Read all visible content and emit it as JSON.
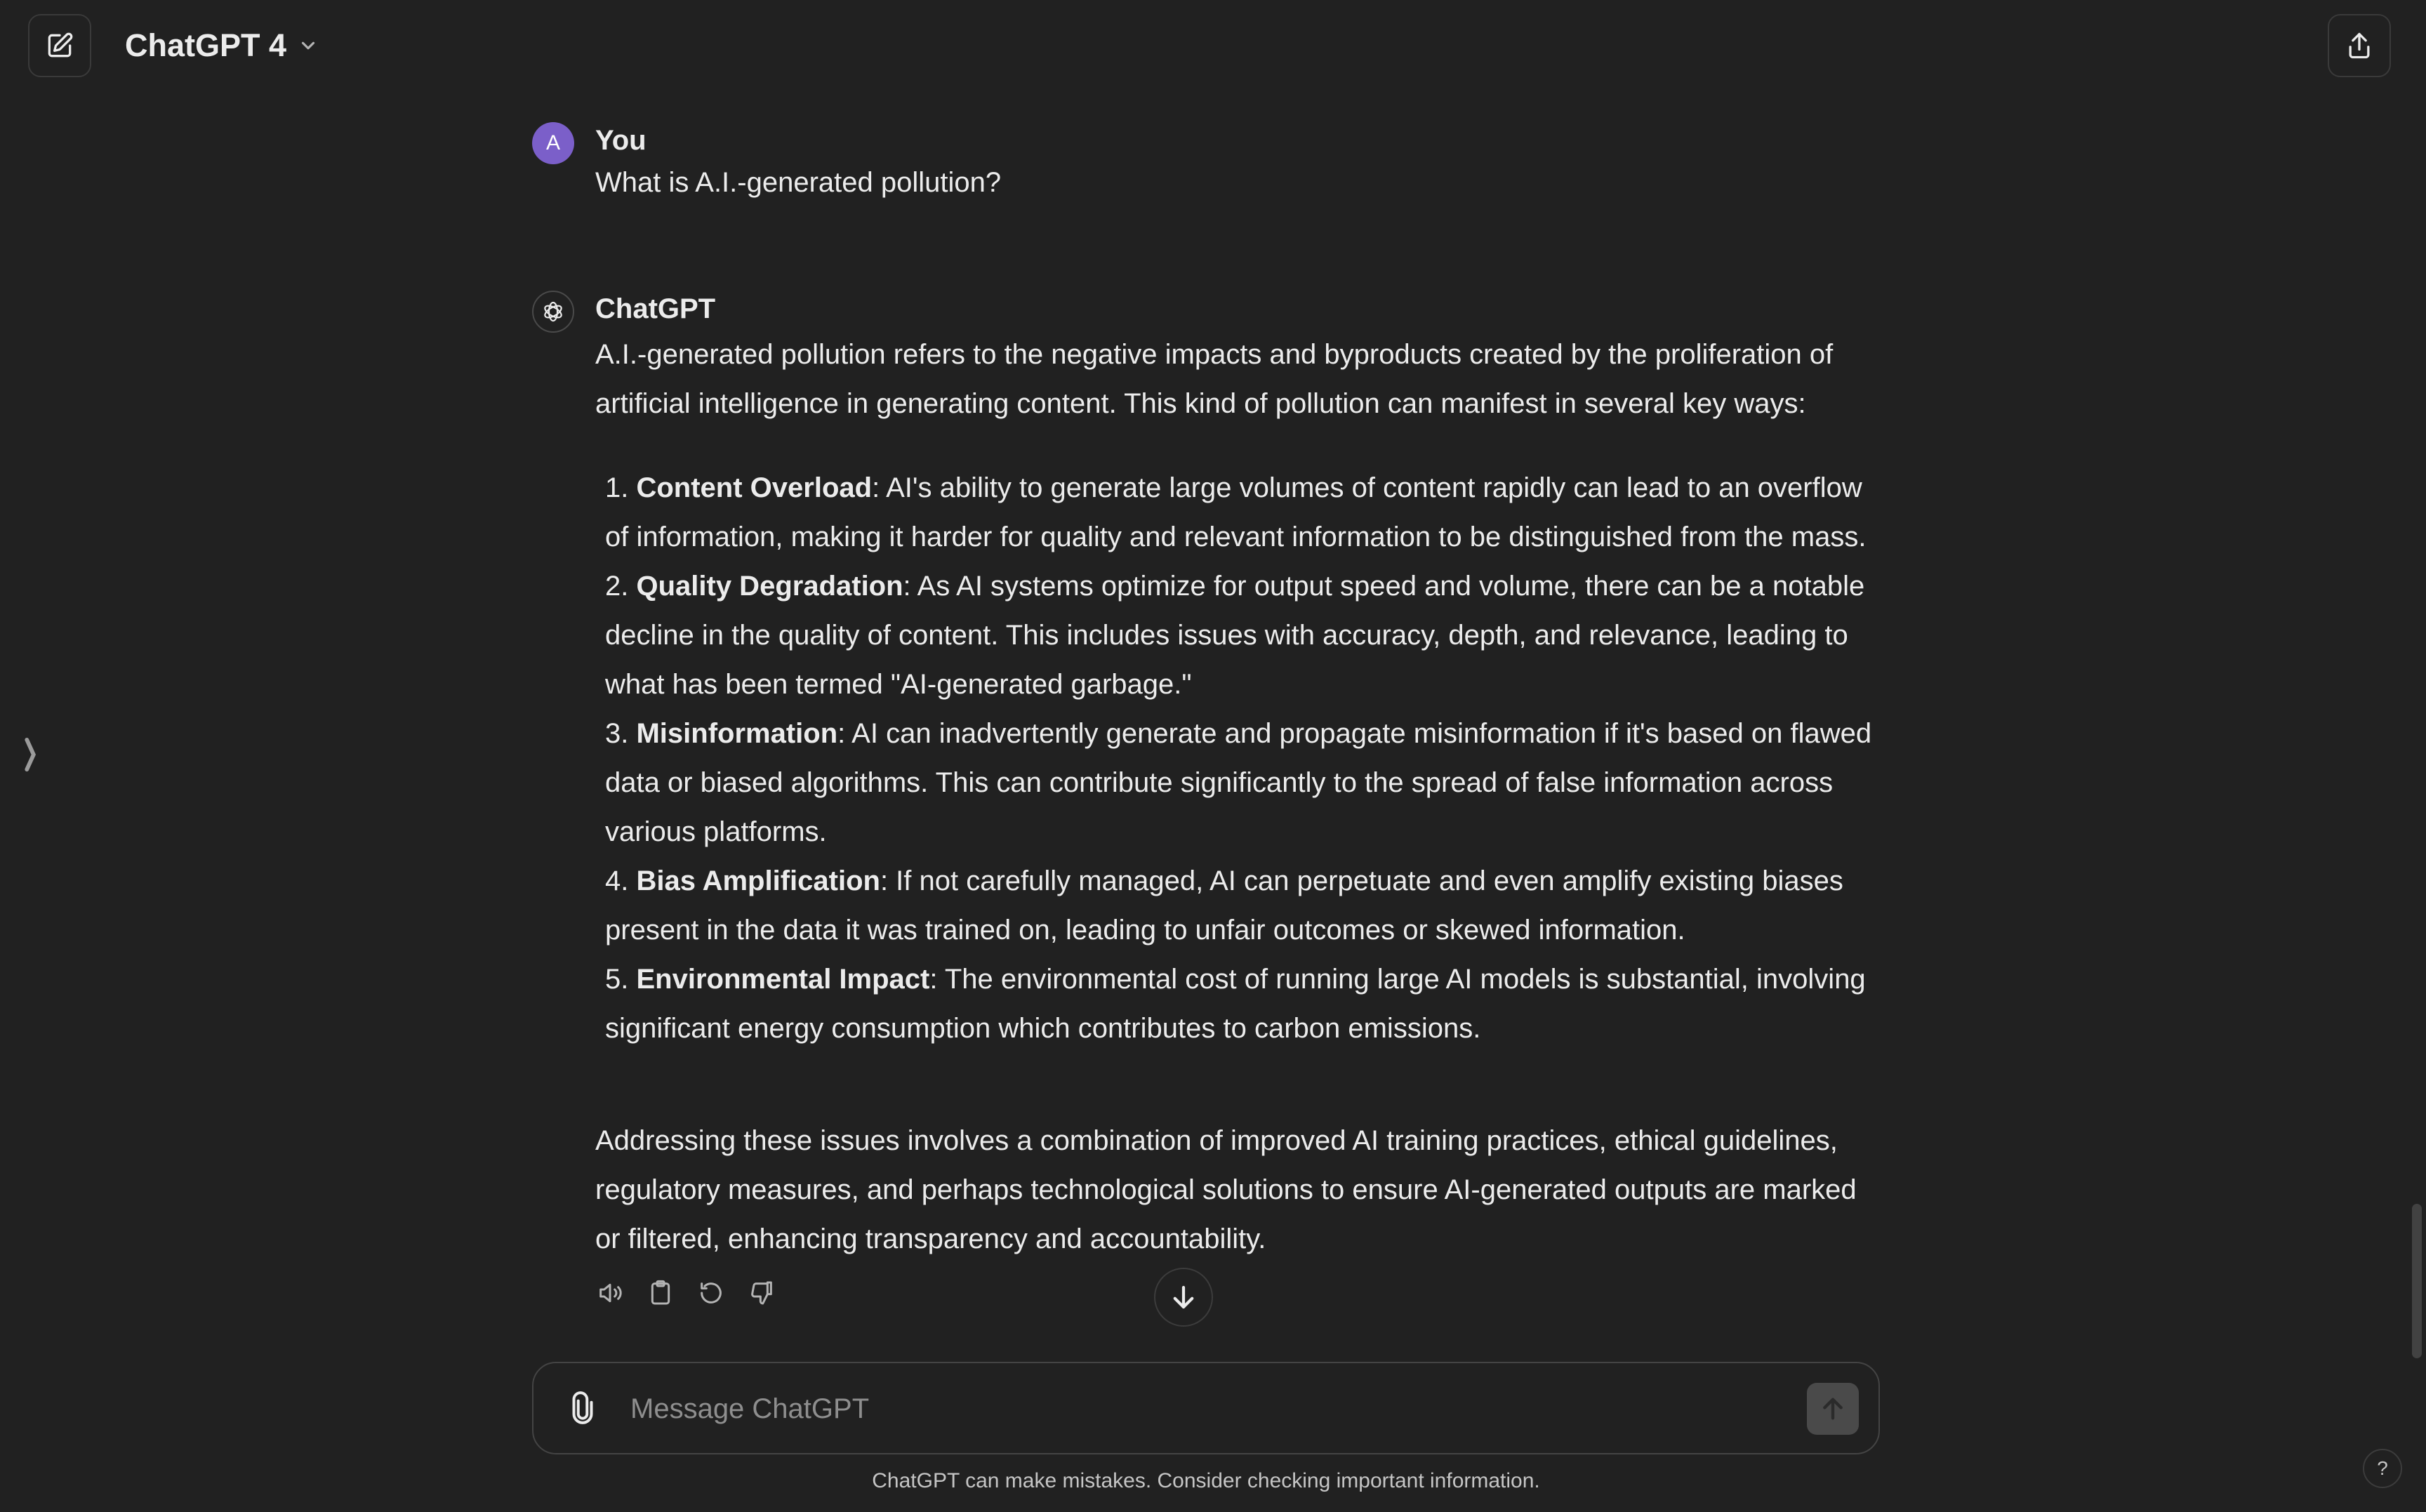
{
  "header": {
    "model_name": "ChatGPT 4",
    "icons": {
      "new_chat": "edit-icon",
      "share": "share-icon",
      "dropdown": "chevron-down-icon"
    }
  },
  "conversation": {
    "user": {
      "avatar_letter": "A",
      "author": "You",
      "text": "What is A.I.-generated pollution?"
    },
    "assistant": {
      "author": "ChatGPT",
      "intro": "A.I.-generated pollution refers to the negative impacts and byproducts created by the proliferation of artificial intelligence in generating content. This kind of pollution can manifest in several key ways:",
      "items": [
        {
          "num": "1.",
          "title": "Content Overload",
          "text": ": AI's ability to generate large volumes of content rapidly can lead to an overflow of information, making it harder for quality and relevant information to be distinguished from the mass."
        },
        {
          "num": "2.",
          "title": "Quality Degradation",
          "text": ": As AI systems optimize for output speed and volume, there can be a notable decline in the quality of content. This includes issues with accuracy, depth, and relevance, leading to what has been termed \"AI-generated garbage.\""
        },
        {
          "num": "3.",
          "title": "Misinformation",
          "text": ": AI can inadvertently generate and propagate misinformation if it's based on flawed data or biased algorithms. This can contribute significantly to the spread of false information across various platforms."
        },
        {
          "num": "4.",
          "title": "Bias Amplification",
          "text": ": If not carefully managed, AI can perpetuate and even amplify existing biases present in the data it was trained on, leading to unfair outcomes or skewed information."
        },
        {
          "num": "5.",
          "title": "Environmental Impact",
          "text": ": The environmental cost of running large AI models is substantial, involving significant energy consumption which contributes to carbon emissions."
        }
      ],
      "closing": "Addressing these issues involves a combination of improved AI training practices, ethical guidelines, regulatory measures, and perhaps technological solutions to ensure AI-generated outputs are marked or filtered, enhancing transparency and accountability."
    }
  },
  "composer": {
    "placeholder": "Message ChatGPT"
  },
  "footer": {
    "disclaimer": "ChatGPT can make mistakes. Consider checking important information.",
    "help_label": "?"
  },
  "sidebar_toggle_glyph": "⟩"
}
